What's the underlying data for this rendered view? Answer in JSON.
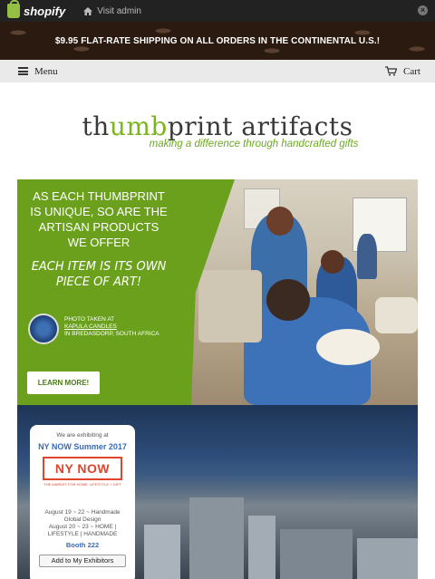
{
  "admin_bar": {
    "brand": "shopify",
    "visit_label": "Visit admin",
    "close_icon": "close-icon",
    "home_icon": "home-icon"
  },
  "promo": {
    "text": "$9.95 FLAT-RATE SHIPPING ON ALL ORDERS IN THE CONTINENTAL U.S.!"
  },
  "nav": {
    "menu_label": "Menu",
    "cart_label": "Cart"
  },
  "site": {
    "logo_a": "th",
    "logo_b": "umb",
    "logo_c": "print artifacts",
    "tagline": "making a difference through handcrafted gifts"
  },
  "hero": {
    "line1": "AS EACH THUMBPRINT",
    "line2": "IS UNIQUE, SO ARE THE",
    "line3": "ARTISAN PRODUCTS",
    "line4": "WE OFFER",
    "script1": "EACH ITEM IS ITS OWN",
    "script2": "PIECE OF ART!",
    "credit1": "PHOTO TAKEN AT",
    "credit2": "KAPULA CANDLES",
    "credit3": "IN BREDASDORP, SOUTH AFRICA",
    "cta": "LEARN MORE!"
  },
  "exhibit": {
    "intro": "We are exhibiting at",
    "show": "NY NOW Summer 2017",
    "logo_text": "NY NOW",
    "logo_sub": "THE MARKET FOR HOME, LIFESTYLE + GIFT",
    "date1": "August 19 ~ 22 ~ Handmade",
    "date1b": "Global Design",
    "date2": "August 20 ~ 23 ~ HOME |",
    "date2b": "LIFESTYLE | HANDMADE",
    "booth": "Booth 222",
    "add_button": "Add to My Exhibitors"
  },
  "colors": {
    "brand_green": "#6aa01c",
    "nynow_red": "#e0442a",
    "link_blue": "#3a6cb5"
  }
}
